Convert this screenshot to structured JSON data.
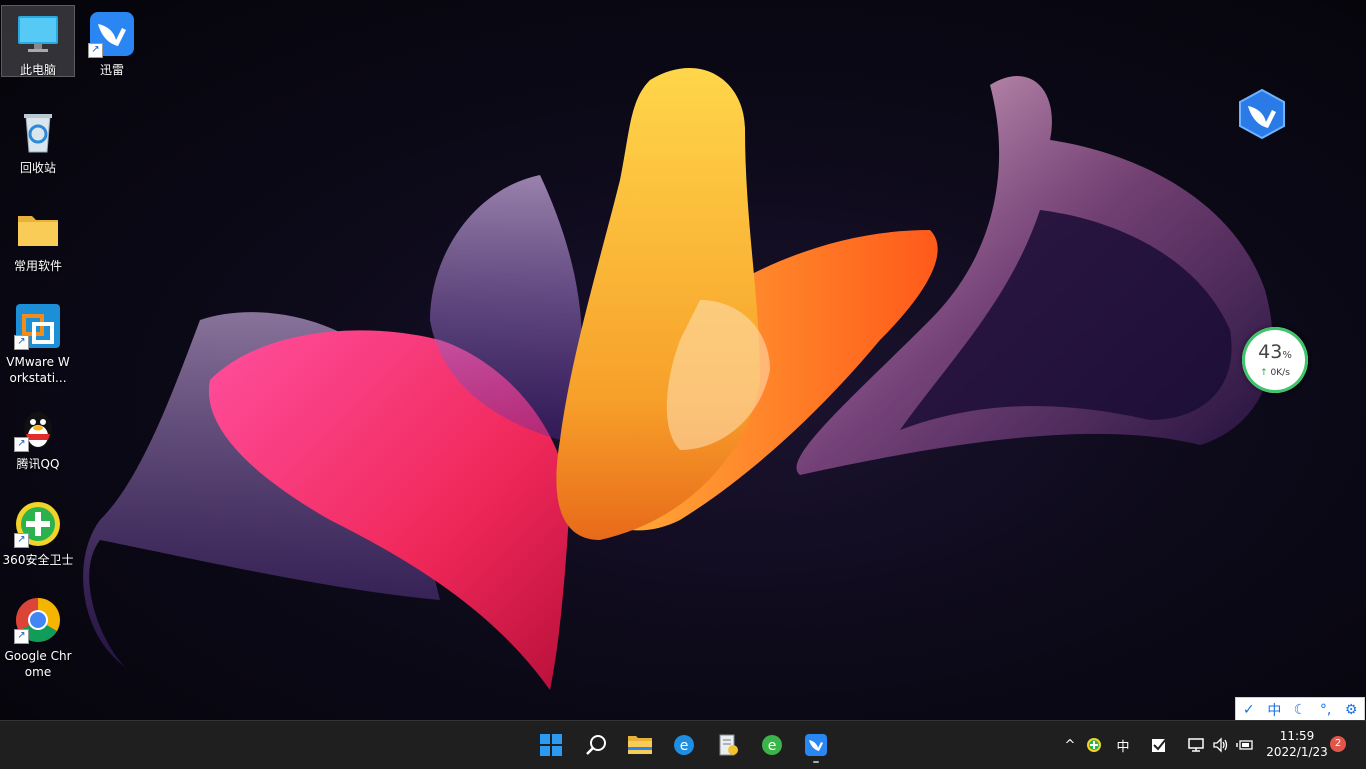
{
  "desktop": {
    "icons": [
      {
        "label": "此电脑",
        "icon": "computer-icon"
      },
      {
        "label": "迅雷",
        "icon": "thunder-icon"
      },
      {
        "label": "回收站",
        "icon": "recycle-bin-icon"
      },
      {
        "label": "常用软件",
        "icon": "folder-icon"
      },
      {
        "label": "VMware Workstati...",
        "icon": "vmware-icon"
      },
      {
        "label": "腾讯QQ",
        "icon": "qq-icon"
      },
      {
        "label": "360安全卫士",
        "icon": "360-icon"
      },
      {
        "label": "Google Chrome",
        "icon": "chrome-icon"
      }
    ]
  },
  "net_widget": {
    "percent": "43",
    "percent_unit": "%",
    "speed": "0K/s",
    "arrow": "↑"
  },
  "ime_toolbar": {
    "items": [
      "✓",
      "中",
      "☾",
      "°,",
      "⚙"
    ]
  },
  "taskbar": {
    "apps": [
      "start-icon",
      "search-icon",
      "file-explorer-icon",
      "ie-icon",
      "notepad-icon",
      "360-browser-icon",
      "thunder-icon"
    ],
    "tray": {
      "chevron": "^",
      "ime_label": "中",
      "clock_time": "11:59",
      "clock_date": "2022/1/23",
      "notification_count": "2"
    }
  },
  "colors": {
    "taskbar": "#1f1f1f",
    "accent": "#1a73e8",
    "widget_ring": "#3fc46a"
  }
}
